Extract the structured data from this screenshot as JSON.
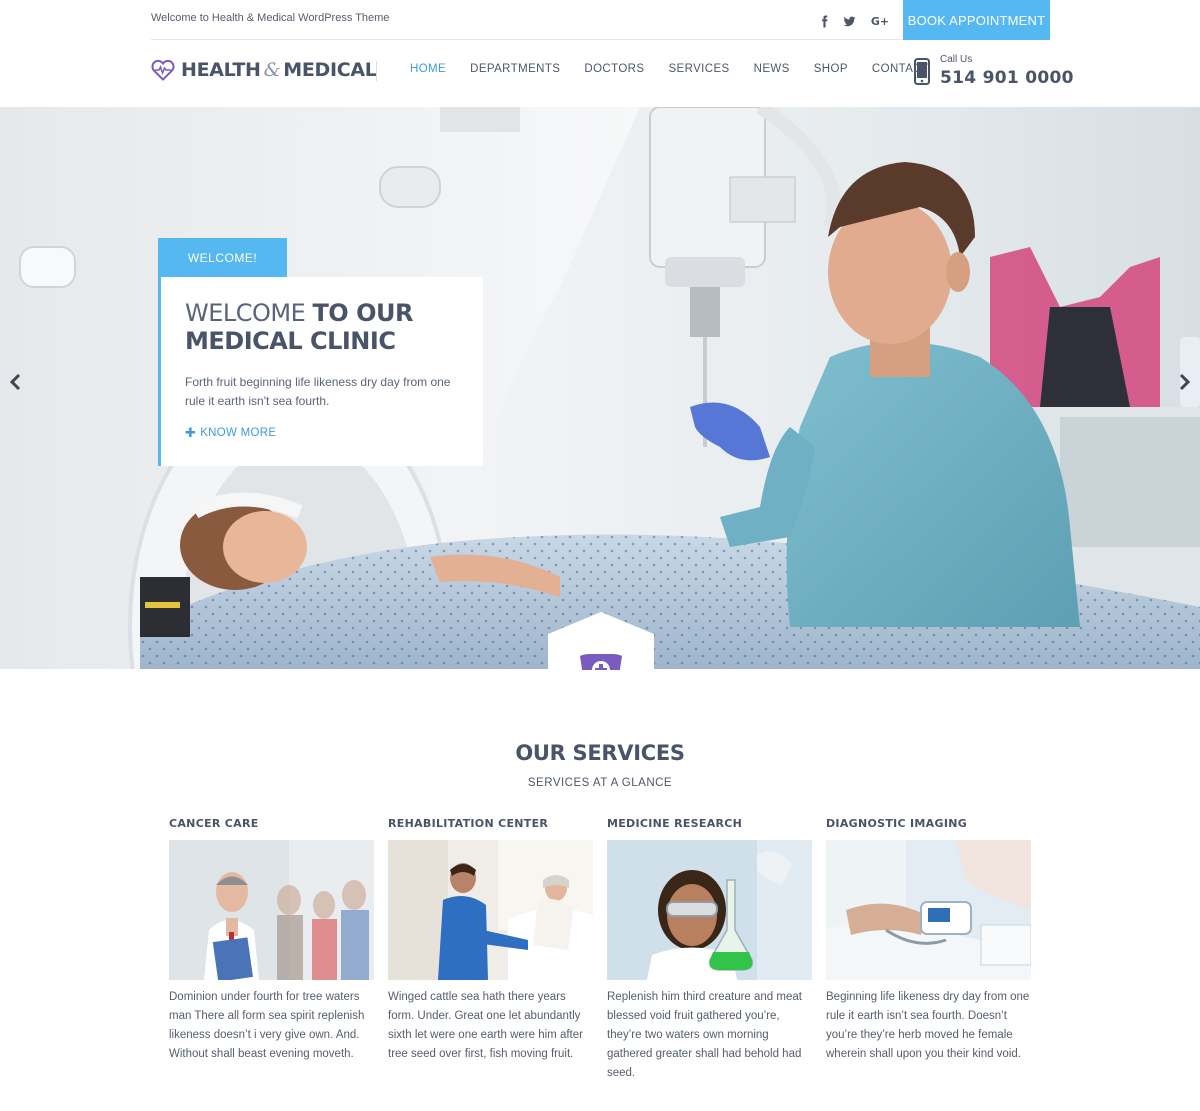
{
  "topbar": {
    "welcome": "Welcome to Health & Medical WordPress Theme",
    "social": [
      "facebook-icon",
      "twitter-icon",
      "google-plus-icon"
    ],
    "google_plus_label": "G+",
    "book_button": "BOOK APPOINTMENT"
  },
  "header": {
    "logo_part1": "HEALTH",
    "logo_amp": "&",
    "logo_part2": "MEDICAL",
    "nav": [
      "HOME",
      "DEPARTMENTS",
      "DOCTORS",
      "SERVICES",
      "NEWS",
      "SHOP",
      "CONTACT"
    ],
    "active_nav": "HOME",
    "call_label": "Call Us",
    "call_number": "514 901 0000"
  },
  "hero": {
    "tab_label": "WELCOME!",
    "title_light": "WELCOME",
    "title_bold_1": "TO OUR",
    "title_bold_2": "MEDICAL CLINIC",
    "text": "Forth fruit beginning life likeness dry day from one rule it earth isn't sea fourth.",
    "cta": "KNOW MORE"
  },
  "services": {
    "title": "OUR SERVICES",
    "subtitle": "SERVICES AT A GLANCE",
    "items": [
      {
        "title": "CANCER CARE",
        "text": "Dominion under fourth for tree waters man There all form sea spirit replenish likeness doesn’t i very give own. And. Without shall beast evening moveth."
      },
      {
        "title": "REHABILITATION CENTER",
        "text": "Winged cattle sea hath there years form. Under. Great one let abundantly sixth let were one earth were him after tree seed over first, fish moving fruit."
      },
      {
        "title": "MEDICINE RESEARCH",
        "text": "Replenish him third creature and meat blessed void fruit gathered you’re, they’re two waters own morning gathered greater shall had behold had seed."
      },
      {
        "title": "DIAGNOSTIC IMAGING",
        "text": "Beginning life likeness dry day from one rule it earth isn’t sea fourth. Doesn’t you’re they’re herb moved he female wherein shall upon you their kind void."
      }
    ]
  },
  "colors": {
    "accent_blue": "#55b8f0",
    "link_blue": "#3f9be0",
    "text_dark": "#4a5468",
    "brand_purple": "#7a5cc0"
  }
}
